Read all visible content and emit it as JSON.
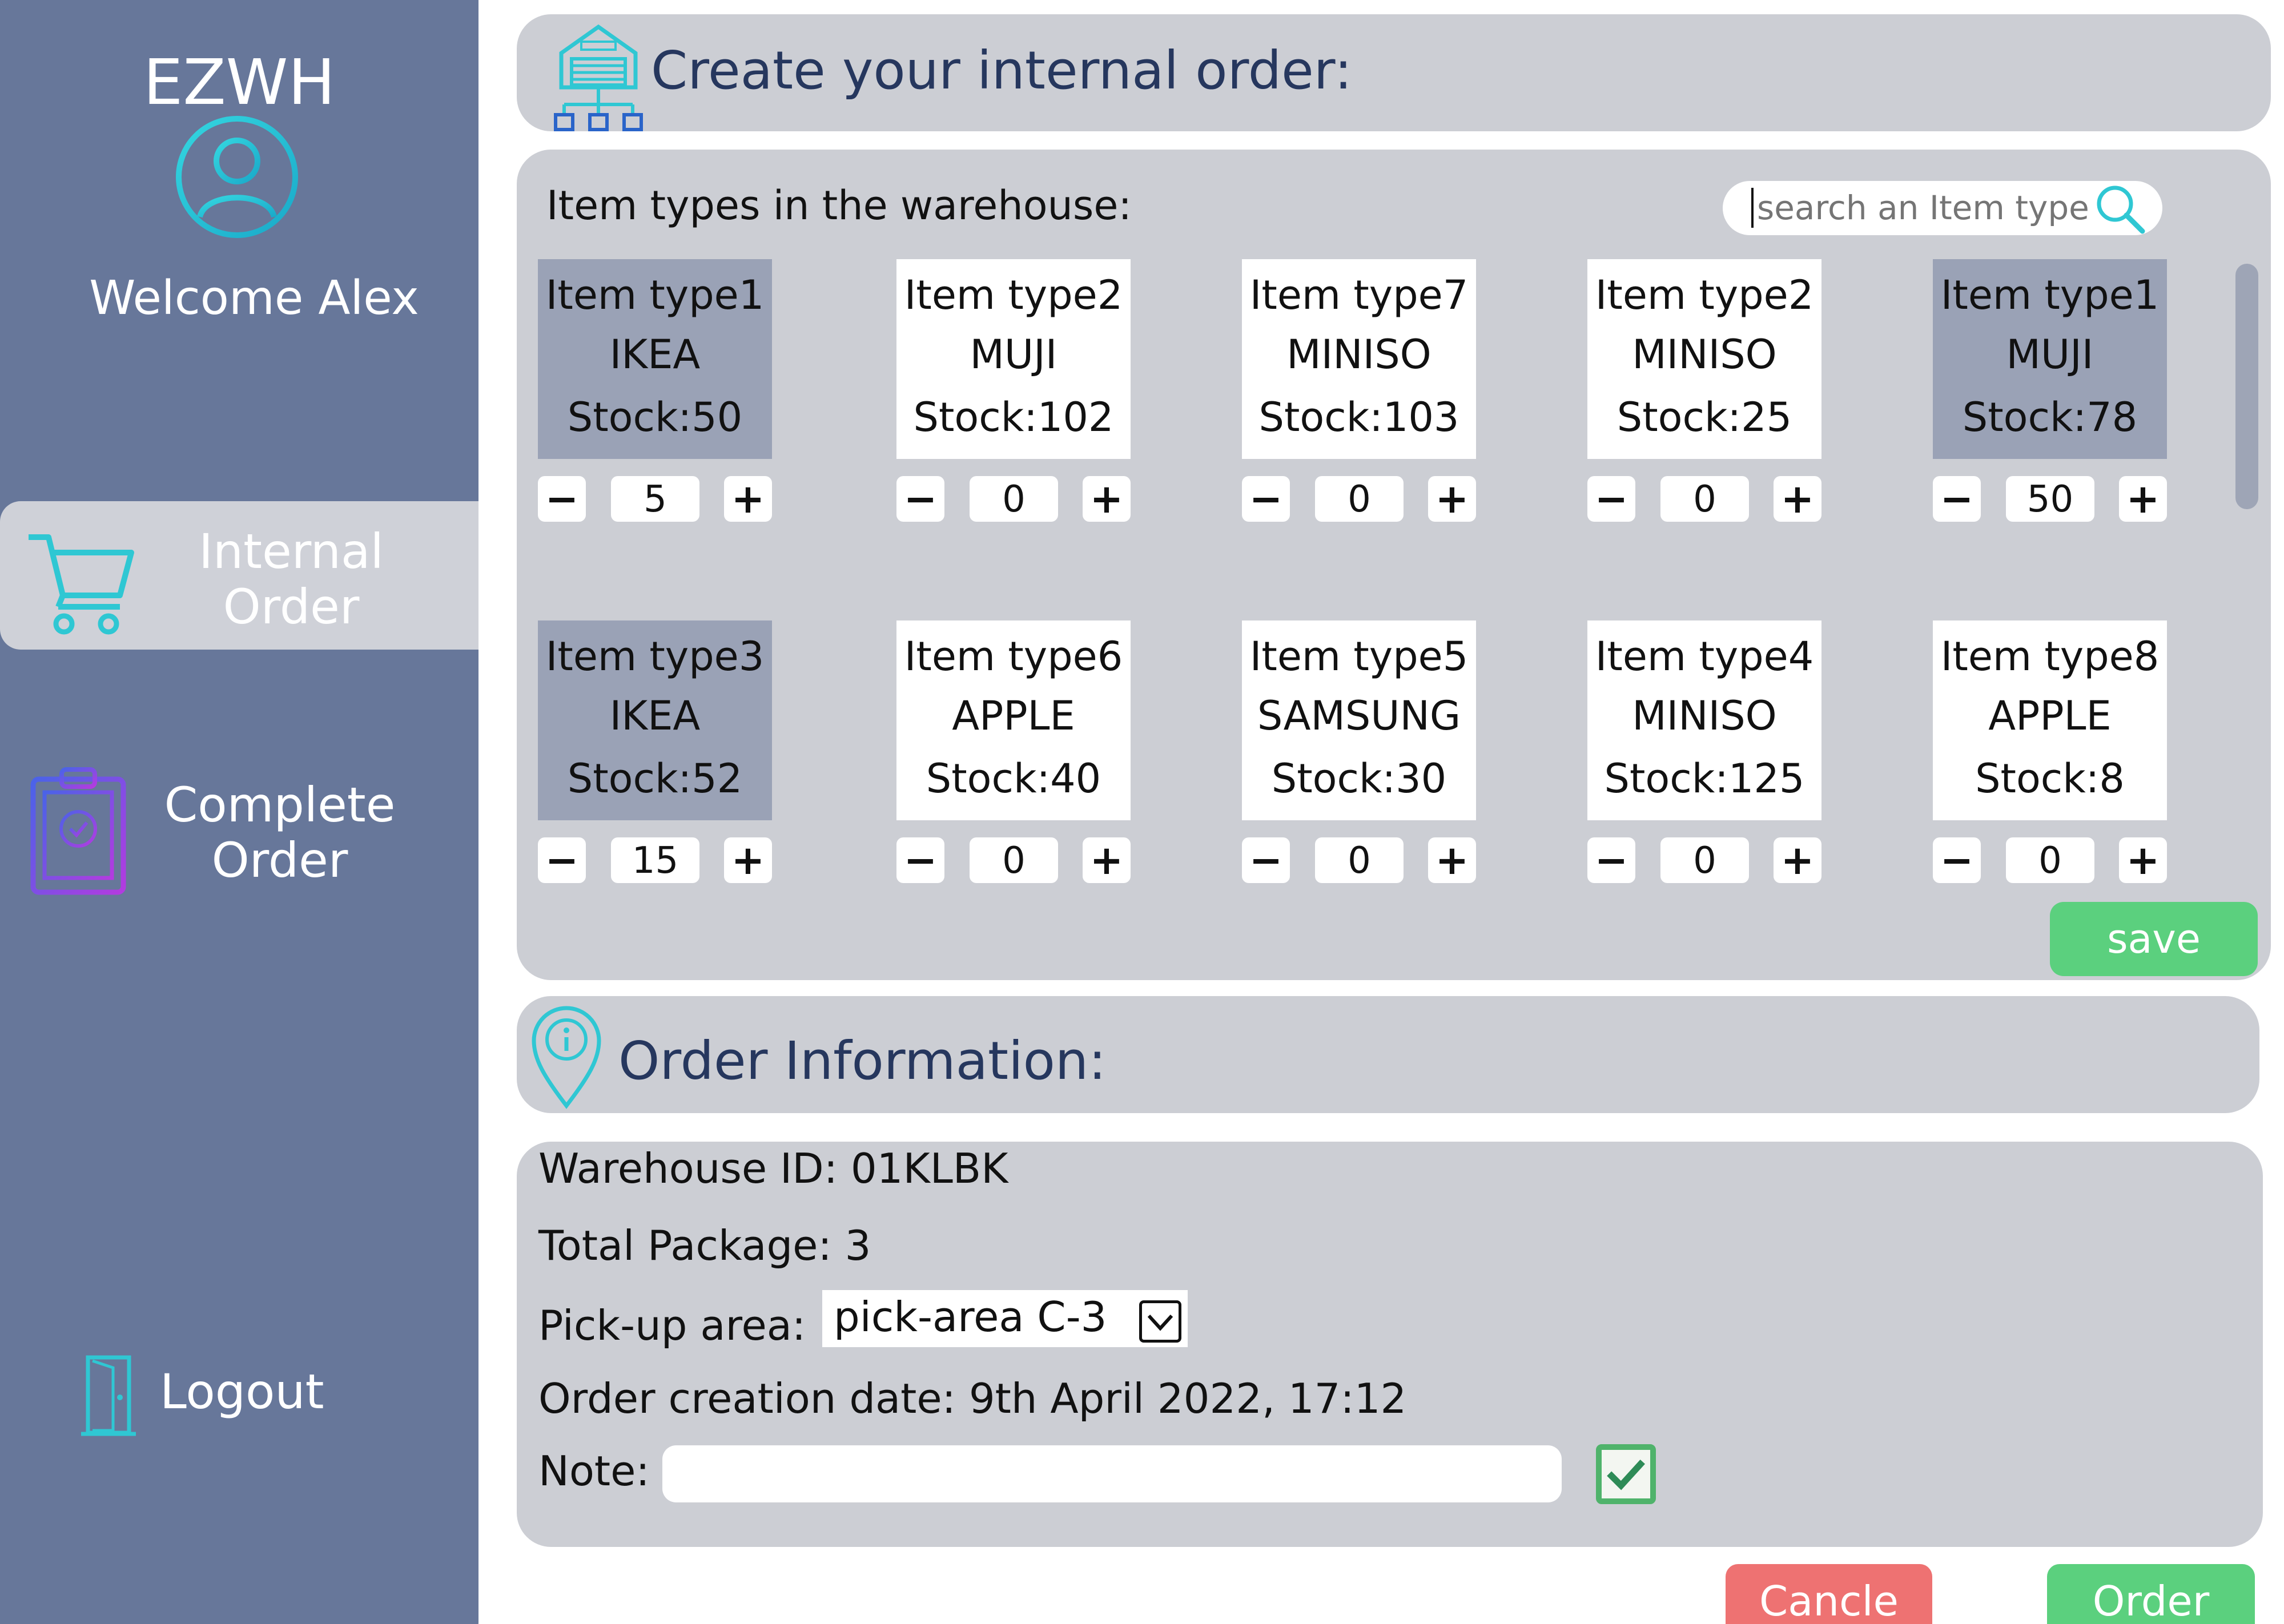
{
  "sidebar": {
    "brand": "EZWH",
    "welcome": "Welcome Alex",
    "nav": {
      "internal_order_line1": "Internal",
      "internal_order_line2": "Order",
      "complete_order_line1": "Complete",
      "complete_order_line2": "Order",
      "logout": "Logout"
    },
    "icons": {
      "avatar": "user-circle-icon",
      "internal_order": "shopping-cart-icon",
      "complete_order": "clipboard-check-icon",
      "logout": "door-icon"
    }
  },
  "header": {
    "title": "Create your internal order:",
    "icon": "warehouse-network-icon"
  },
  "items": {
    "title": "Item types in the warehouse:",
    "search": {
      "placeholder": "search an Item type",
      "icon": "search-icon"
    },
    "cards": [
      {
        "name": "Item type1",
        "brand": "IKEA",
        "stock": "Stock:50",
        "qty": "5",
        "selected": true
      },
      {
        "name": "Item type2",
        "brand": "MUJI",
        "stock": "Stock:102",
        "qty": "0",
        "selected": false
      },
      {
        "name": "Item type7",
        "brand": "MINISO",
        "stock": "Stock:103",
        "qty": "0",
        "selected": false
      },
      {
        "name": "Item type2",
        "brand": "MINISO",
        "stock": "Stock:25",
        "qty": "0",
        "selected": false
      },
      {
        "name": "Item type1",
        "brand": "MUJI",
        "stock": "Stock:78",
        "qty": "50",
        "selected": true
      },
      {
        "name": "Item type3",
        "brand": "IKEA",
        "stock": "Stock:52",
        "qty": "15",
        "selected": true
      },
      {
        "name": "Item type6",
        "brand": "APPLE",
        "stock": "Stock:40",
        "qty": "0",
        "selected": false
      },
      {
        "name": "Item type5",
        "brand": "SAMSUNG",
        "stock": "Stock:30",
        "qty": "0",
        "selected": false
      },
      {
        "name": "Item type4",
        "brand": "MINISO",
        "stock": "Stock:125",
        "qty": "0",
        "selected": false
      },
      {
        "name": "Item type8",
        "brand": "APPLE",
        "stock": "Stock:8",
        "qty": "0",
        "selected": false
      }
    ],
    "minus_label": "−",
    "plus_label": "+",
    "save_label": "save"
  },
  "order_info": {
    "title": "Order Information:",
    "icon": "info-pin-icon",
    "warehouse_id": "Warehouse ID: 01KLBK",
    "total_package": "Total Package: 3",
    "pickup_label": "Pick-up area:",
    "pickup_value": "pick-area C-3",
    "creation_date": "Order creation date: 9th April 2022, 17:12",
    "note_label": "Note:",
    "note_value": "",
    "confirm_checked": true
  },
  "actions": {
    "cancel_label": "Cancle",
    "order_label": "Order"
  },
  "colors": {
    "sidebar": "#67779a",
    "panel": "#ccced4",
    "selected_card": "#9aa2b6",
    "accent_cyan": "#2fc7d3",
    "save_green": "#5bd07e",
    "cancel_red": "#ee7272",
    "title_navy": "#26375e"
  }
}
